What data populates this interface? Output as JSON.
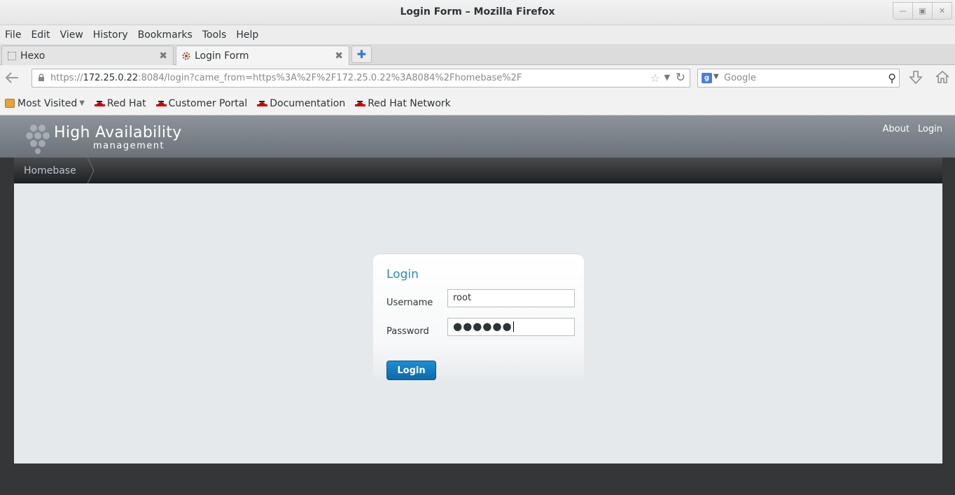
{
  "window": {
    "title": "Login Form – Mozilla Firefox",
    "controls": [
      "minimize",
      "maximize",
      "close"
    ]
  },
  "menu": [
    "File",
    "Edit",
    "View",
    "History",
    "Bookmarks",
    "Tools",
    "Help"
  ],
  "tabs": [
    {
      "label": "Hexo",
      "active": false
    },
    {
      "label": "Login Form",
      "active": true
    }
  ],
  "navbar": {
    "url_prefix": "https://",
    "url_host": "172.25.0.22",
    "url_rest": ":8084/login?came_from=https%3A%2F%2F172.25.0.22%3A8084%2Fhomebase%2F",
    "search_placeholder": "Google"
  },
  "bookmarks": [
    "Most Visited",
    "Red Hat",
    "Customer Portal",
    "Documentation",
    "Red Hat Network"
  ],
  "app": {
    "title": "High Availability",
    "subtitle": "management",
    "links": [
      "About",
      "Login"
    ],
    "breadcrumb": "Homebase"
  },
  "login": {
    "heading": "Login",
    "username_label": "Username",
    "username_value": "root",
    "password_label": "Password",
    "password_masked": "●●●●●●",
    "button_label": "Login"
  },
  "colors": {
    "accent": "#2a8ac0",
    "button": "#0d6aa8",
    "banner": "#7b8288",
    "content_bg": "#e6e9ec"
  }
}
